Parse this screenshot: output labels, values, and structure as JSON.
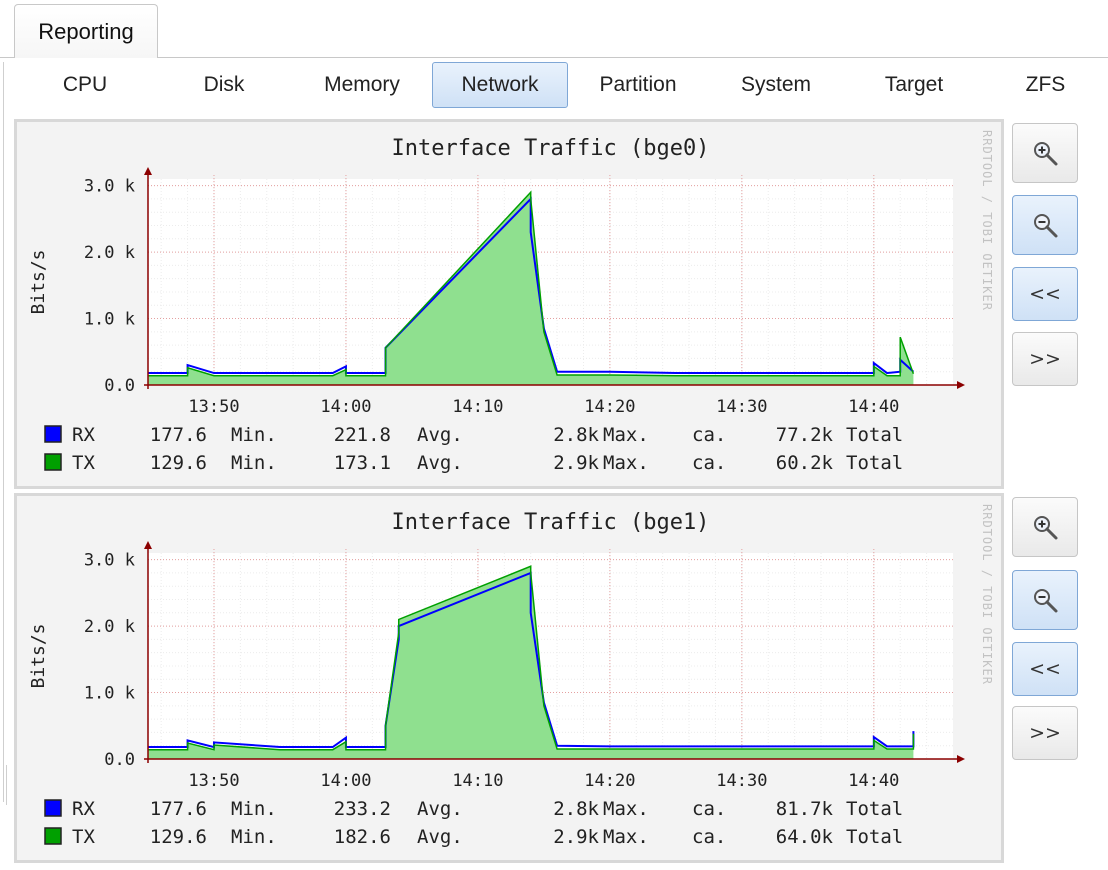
{
  "main_tab": "Reporting",
  "subtabs": [
    {
      "label": "CPU",
      "active": false
    },
    {
      "label": "Disk",
      "active": false
    },
    {
      "label": "Memory",
      "active": false
    },
    {
      "label": "Network",
      "active": true
    },
    {
      "label": "Partition",
      "active": false
    },
    {
      "label": "System",
      "active": false
    },
    {
      "label": "Target",
      "active": false
    },
    {
      "label": "ZFS",
      "active": false
    }
  ],
  "controls": {
    "zoom_in_icon": "zoom-in-icon",
    "zoom_out_icon": "zoom-out-icon",
    "back_label": "<<",
    "forward_label": ">>"
  },
  "colors": {
    "rx": "#0000ff",
    "tx": "#00a000",
    "tx_fill": "#8fe08f",
    "axis": "#8b0000",
    "grid": "#e4a0a0"
  },
  "chart_data": [
    {
      "type": "line",
      "title": "Interface Traffic (bge0)",
      "ylabel": "Bits/s",
      "watermark": "RRDTOOL / TOBI OETIKER",
      "ylim": [
        0,
        3100
      ],
      "xlim": [
        "13:45",
        "14:46"
      ],
      "yticks": [
        {
          "v": 0,
          "label": "0.0"
        },
        {
          "v": 1000,
          "label": "1.0 k"
        },
        {
          "v": 2000,
          "label": "2.0 k"
        },
        {
          "v": 3000,
          "label": "3.0 k"
        }
      ],
      "xticks": [
        "13:50",
        "14:00",
        "14:10",
        "14:20",
        "14:30",
        "14:40"
      ],
      "series": [
        {
          "name": "RX",
          "x": [
            "13:45",
            "13:48",
            "13:48",
            "13:50",
            "13:55",
            "13:59",
            "14:00",
            "14:00",
            "14:03",
            "14:03",
            "14:14",
            "14:14",
            "14:15",
            "14:16",
            "14:20",
            "14:25",
            "14:30",
            "14:35",
            "14:38",
            "14:40",
            "14:40",
            "14:41",
            "14:42",
            "14:42",
            "14:43"
          ],
          "y": [
            180,
            180,
            300,
            180,
            180,
            180,
            280,
            180,
            180,
            560,
            2800,
            2300,
            850,
            200,
            200,
            180,
            180,
            180,
            180,
            180,
            330,
            180,
            200,
            380,
            200
          ]
        },
        {
          "name": "TX",
          "x": [
            "13:45",
            "13:48",
            "13:48",
            "13:50",
            "13:55",
            "13:59",
            "14:00",
            "14:00",
            "14:03",
            "14:03",
            "14:14",
            "14:14",
            "14:15",
            "14:16",
            "14:20",
            "14:25",
            "14:30",
            "14:35",
            "14:38",
            "14:40",
            "14:40",
            "14:41",
            "14:42",
            "14:42",
            "14:43"
          ],
          "y": [
            140,
            140,
            260,
            140,
            140,
            140,
            230,
            140,
            140,
            560,
            2900,
            2800,
            800,
            150,
            150,
            140,
            140,
            140,
            140,
            140,
            280,
            140,
            140,
            720,
            170
          ]
        }
      ],
      "legend": [
        {
          "name": "RX",
          "min": "177.6",
          "min_label": "Min.",
          "avg": "221.8",
          "avg_label": "Avg.",
          "max": "2.8k",
          "max_label": "Max.",
          "ca": "ca.",
          "total": "77.2k",
          "total_label": "Total"
        },
        {
          "name": "TX",
          "min": "129.6",
          "min_label": "Min.",
          "avg": "173.1",
          "avg_label": "Avg.",
          "max": "2.9k",
          "max_label": "Max.",
          "ca": "ca.",
          "total": "60.2k",
          "total_label": "Total"
        }
      ]
    },
    {
      "type": "line",
      "title": "Interface Traffic (bge1)",
      "ylabel": "Bits/s",
      "watermark": "RRDTOOL / TOBI OETIKER",
      "ylim": [
        0,
        3100
      ],
      "xlim": [
        "13:45",
        "14:46"
      ],
      "yticks": [
        {
          "v": 0,
          "label": "0.0"
        },
        {
          "v": 1000,
          "label": "1.0 k"
        },
        {
          "v": 2000,
          "label": "2.0 k"
        },
        {
          "v": 3000,
          "label": "3.0 k"
        }
      ],
      "xticks": [
        "13:50",
        "14:00",
        "14:10",
        "14:20",
        "14:30",
        "14:40"
      ],
      "series": [
        {
          "name": "RX",
          "x": [
            "13:45",
            "13:48",
            "13:48",
            "13:50",
            "13:50",
            "13:55",
            "13:59",
            "14:00",
            "14:00",
            "14:03",
            "14:03",
            "14:04",
            "14:04",
            "14:14",
            "14:14",
            "14:15",
            "14:16",
            "14:20",
            "14:25",
            "14:30",
            "14:35",
            "14:38",
            "14:40",
            "14:40",
            "14:41",
            "14:42",
            "14:43",
            "14:43"
          ],
          "y": [
            180,
            180,
            280,
            180,
            250,
            180,
            180,
            320,
            180,
            180,
            500,
            1800,
            2000,
            2800,
            2200,
            850,
            200,
            190,
            190,
            190,
            190,
            190,
            190,
            330,
            190,
            190,
            190,
            420
          ]
        },
        {
          "name": "TX",
          "x": [
            "13:45",
            "13:48",
            "13:48",
            "13:50",
            "13:50",
            "13:55",
            "13:59",
            "14:00",
            "14:00",
            "14:03",
            "14:03",
            "14:04",
            "14:04",
            "14:14",
            "14:14",
            "14:15",
            "14:16",
            "14:20",
            "14:25",
            "14:30",
            "14:35",
            "14:38",
            "14:40",
            "14:40",
            "14:41",
            "14:42",
            "14:43",
            "14:43"
          ],
          "y": [
            140,
            140,
            240,
            140,
            210,
            140,
            140,
            260,
            140,
            140,
            500,
            1900,
            2100,
            2900,
            2800,
            800,
            150,
            150,
            150,
            150,
            150,
            150,
            150,
            280,
            150,
            150,
            150,
            380
          ]
        }
      ],
      "legend": [
        {
          "name": "RX",
          "min": "177.6",
          "min_label": "Min.",
          "avg": "233.2",
          "avg_label": "Avg.",
          "max": "2.8k",
          "max_label": "Max.",
          "ca": "ca.",
          "total": "81.7k",
          "total_label": "Total"
        },
        {
          "name": "TX",
          "min": "129.6",
          "min_label": "Min.",
          "avg": "182.6",
          "avg_label": "Avg.",
          "max": "2.9k",
          "max_label": "Max.",
          "ca": "ca.",
          "total": "64.0k",
          "total_label": "Total"
        }
      ]
    }
  ]
}
